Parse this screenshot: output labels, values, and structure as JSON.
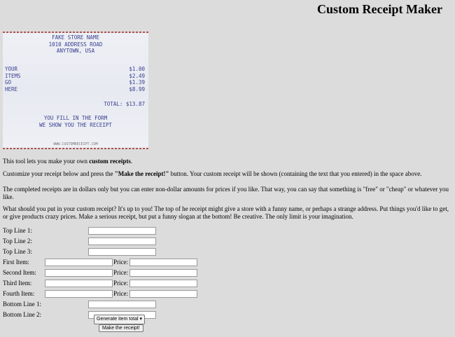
{
  "page": {
    "title": "Custom Receipt Maker"
  },
  "receipt": {
    "header_lines": [
      "FAKE STORE NAME",
      "1010 ADDRESS ROAD",
      "ANYTOWN, USA"
    ],
    "items": [
      {
        "name": "YOUR",
        "price": "$1.00"
      },
      {
        "name": "ITEMS",
        "price": "$2.49"
      },
      {
        "name": "GO",
        "price": "$1.39"
      },
      {
        "name": "HERE",
        "price": "$8.99"
      }
    ],
    "total": "TOTAL: $13.87",
    "footer_lines": [
      "YOU FILL IN THE FORM",
      "WE SHOW YOU THE RECEIPT"
    ],
    "site": "WWW.CUSTOMRECEIPT.COM"
  },
  "description": {
    "p1_pre": "This tool lets you make your own ",
    "p1_bold": "custom receipts",
    "p1_post": ".",
    "p2_pre": "Customize your receipt below and press the ",
    "p2_bold": "\"Make the receipt!\"",
    "p2_post": " button. Your custom receipt will be shown (containing the text that you entered) in the space above.",
    "p3": "The completed receipts are in dollars only but you can enter non-dollar amounts for prices if you like. That way, you can say that something is \"free\" or \"cheap\" or whatever you like.",
    "p4": "What should you put in your custom receipt? It's up to you! The top of he receipt might give a store with a funny name, or perhaps a strange address. Put things you'd like to get, or give products crazy prices. Make a serious receipt, but put a funny slogan at the bottom! Be creative. The only limit is your imagination."
  },
  "form": {
    "top_line_1": "Top Line 1:",
    "top_line_2": "Top Line 2:",
    "top_line_3": "Top Line 3:",
    "first_item": "First Item:",
    "second_item": "Second Item:",
    "third_item": "Third Item:",
    "fourth_item": "Fourth Item:",
    "price": "Price:",
    "bottom_line_1": "Bottom Line 1:",
    "bottom_line_2": "Bottom Line 2:",
    "total_select": "Generate item total",
    "submit": "Make the receipt!"
  }
}
